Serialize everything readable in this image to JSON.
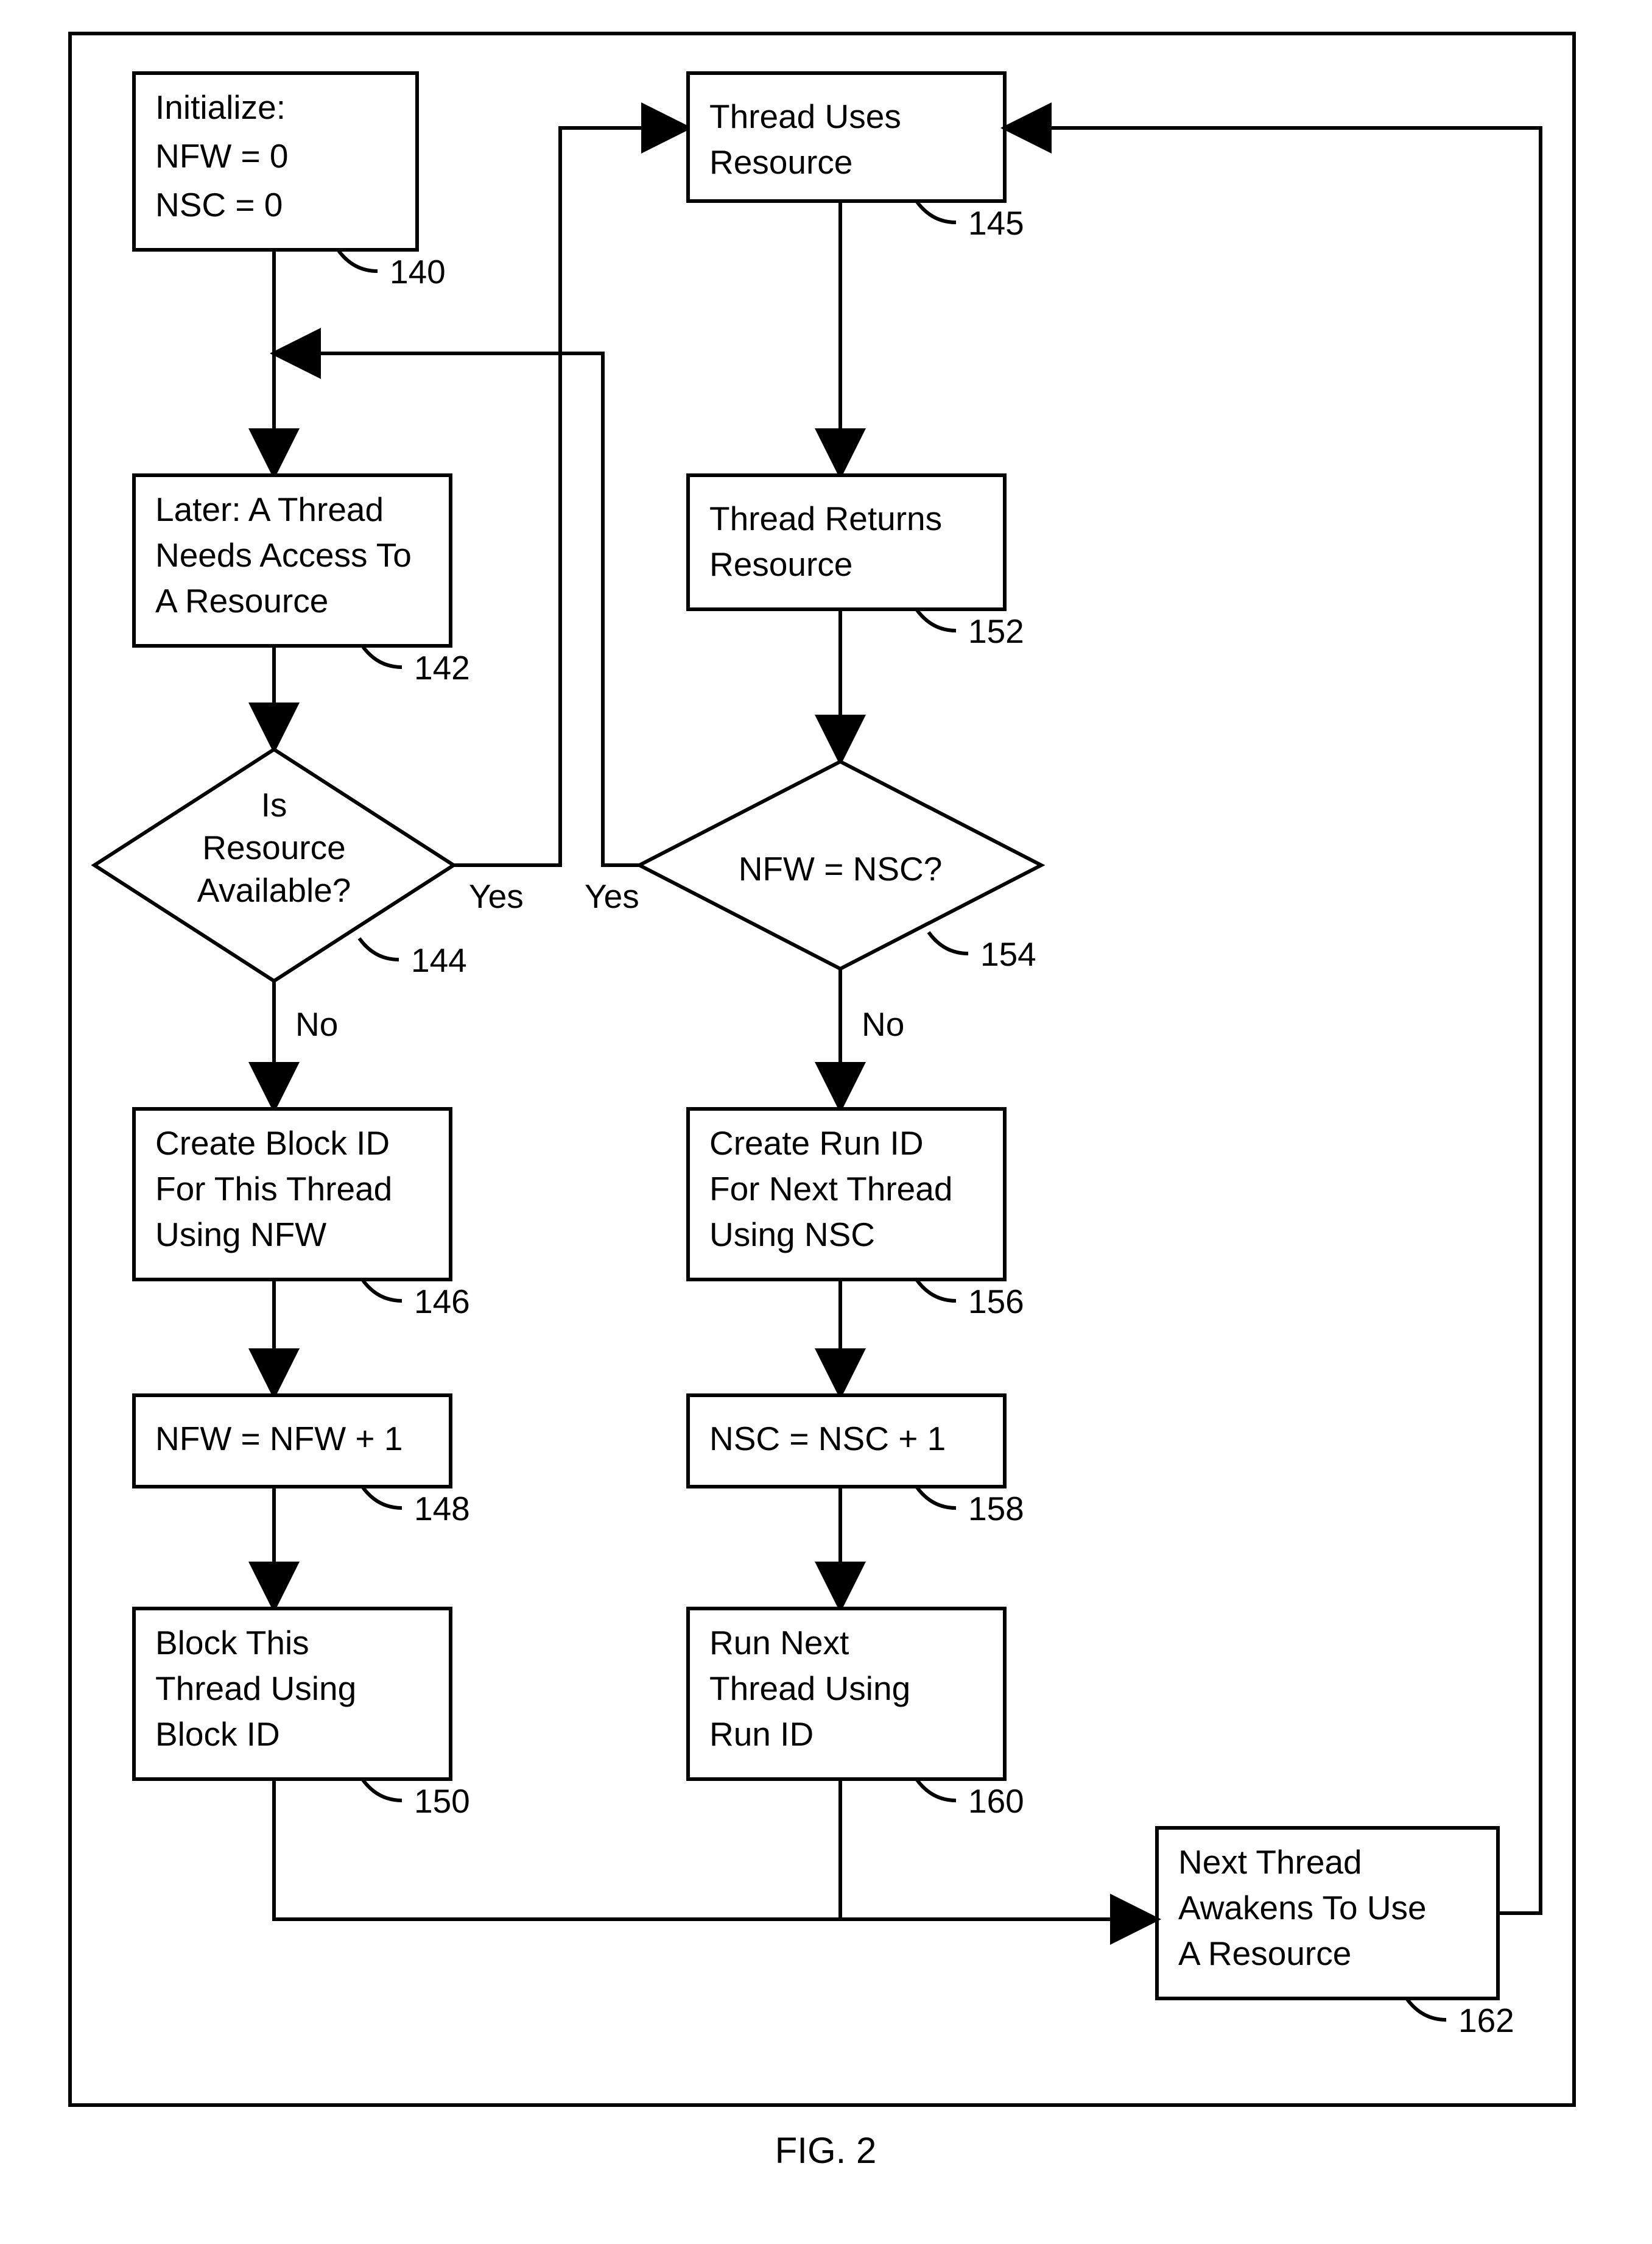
{
  "figure_label": "FIG. 2",
  "nodes": {
    "n140": {
      "ref": "140",
      "lines": [
        "Initialize:",
        "  NFW = 0",
        "  NSC = 0"
      ]
    },
    "n142": {
      "ref": "142",
      "lines": [
        "Later:  A Thread",
        "Needs Access To",
        "A Resource"
      ]
    },
    "n144": {
      "ref": "144",
      "lines": [
        "Is",
        "Resource",
        "Available?"
      ]
    },
    "n145": {
      "ref": "145",
      "lines": [
        "Thread Uses",
        "Resource"
      ]
    },
    "n146": {
      "ref": "146",
      "lines": [
        "Create Block ID",
        "For This Thread",
        "Using NFW"
      ]
    },
    "n148": {
      "ref": "148",
      "lines": [
        "NFW = NFW + 1"
      ]
    },
    "n150": {
      "ref": "150",
      "lines": [
        "Block This",
        "Thread Using",
        "Block ID"
      ]
    },
    "n152": {
      "ref": "152",
      "lines": [
        "Thread Returns",
        "Resource"
      ]
    },
    "n154": {
      "ref": "154",
      "lines": [
        "NFW = NSC?"
      ]
    },
    "n156": {
      "ref": "156",
      "lines": [
        "Create Run ID",
        "For Next Thread",
        "Using NSC"
      ]
    },
    "n158": {
      "ref": "158",
      "lines": [
        "NSC = NSC + 1"
      ]
    },
    "n160": {
      "ref": "160",
      "lines": [
        "Run Next",
        "Thread Using",
        "Run ID"
      ]
    },
    "n162": {
      "ref": "162",
      "lines": [
        "Next Thread",
        "Awakens To Use",
        "A Resource"
      ]
    }
  },
  "edge_labels": {
    "e144_yes": "Yes",
    "e144_no": "No",
    "e154_yes": "Yes",
    "e154_no": "No"
  },
  "chart_data": {
    "type": "diagram",
    "nodes": [
      {
        "id": 140,
        "shape": "rect",
        "text": "Initialize: NFW = 0; NSC = 0"
      },
      {
        "id": 142,
        "shape": "rect",
        "text": "Later: A Thread Needs Access To A Resource"
      },
      {
        "id": 144,
        "shape": "diamond",
        "text": "Is Resource Available?"
      },
      {
        "id": 145,
        "shape": "rect",
        "text": "Thread Uses Resource"
      },
      {
        "id": 146,
        "shape": "rect",
        "text": "Create Block ID For This Thread Using NFW"
      },
      {
        "id": 148,
        "shape": "rect",
        "text": "NFW = NFW + 1"
      },
      {
        "id": 150,
        "shape": "rect",
        "text": "Block This Thread Using Block ID"
      },
      {
        "id": 152,
        "shape": "rect",
        "text": "Thread Returns Resource"
      },
      {
        "id": 154,
        "shape": "diamond",
        "text": "NFW = NSC?"
      },
      {
        "id": 156,
        "shape": "rect",
        "text": "Create Run ID For Next Thread Using NSC"
      },
      {
        "id": 158,
        "shape": "rect",
        "text": "NSC = NSC + 1"
      },
      {
        "id": 160,
        "shape": "rect",
        "text": "Run Next Thread Using Run ID"
      },
      {
        "id": 162,
        "shape": "rect",
        "text": "Next Thread Awakens To Use A Resource"
      }
    ],
    "edges": [
      {
        "from": 140,
        "to": 142
      },
      {
        "from": 142,
        "to": 144
      },
      {
        "from": 144,
        "to": 145,
        "label": "Yes"
      },
      {
        "from": 144,
        "to": 146,
        "label": "No"
      },
      {
        "from": 146,
        "to": 148
      },
      {
        "from": 148,
        "to": 150
      },
      {
        "from": 150,
        "to": 162
      },
      {
        "from": 145,
        "to": 152
      },
      {
        "from": 152,
        "to": 154
      },
      {
        "from": 154,
        "to": 142,
        "label": "Yes"
      },
      {
        "from": 154,
        "to": 156,
        "label": "No"
      },
      {
        "from": 156,
        "to": 158
      },
      {
        "from": 158,
        "to": 160
      },
      {
        "from": 160,
        "to": 162
      },
      {
        "from": 162,
        "to": 145
      }
    ]
  }
}
